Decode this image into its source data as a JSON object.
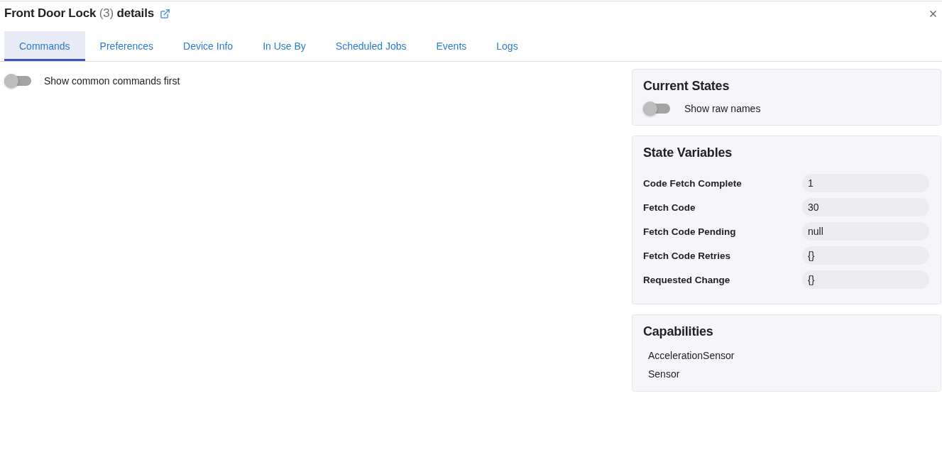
{
  "header": {
    "title": {
      "name": "Front Door Lock",
      "number": "(3)",
      "suffix": "details"
    }
  },
  "tabs": [
    {
      "label": "Commands",
      "selected": true
    },
    {
      "label": "Preferences",
      "selected": false
    },
    {
      "label": "Device Info",
      "selected": false
    },
    {
      "label": "In Use By",
      "selected": false
    },
    {
      "label": "Scheduled Jobs",
      "selected": false
    },
    {
      "label": "Events",
      "selected": false
    },
    {
      "label": "Logs",
      "selected": false
    }
  ],
  "commands": {
    "toggle": {
      "label": "Show common commands first",
      "on": false
    }
  },
  "current_states": {
    "title": "Current States",
    "toggle": {
      "label": "Show raw names",
      "on": false
    }
  },
  "state_variables": {
    "title": "State Variables",
    "rows": [
      {
        "name": "Code Fetch Complete",
        "value": "1"
      },
      {
        "name": "Fetch Code",
        "value": "30"
      },
      {
        "name": "Fetch Code Pending",
        "value": "null"
      },
      {
        "name": "Fetch Code Retries",
        "value": "{}"
      },
      {
        "name": "Requested Change",
        "value": "{}"
      }
    ]
  },
  "capabilities": {
    "title": "Capabilities",
    "items": [
      "AccelerationSensor",
      "Sensor"
    ]
  }
}
